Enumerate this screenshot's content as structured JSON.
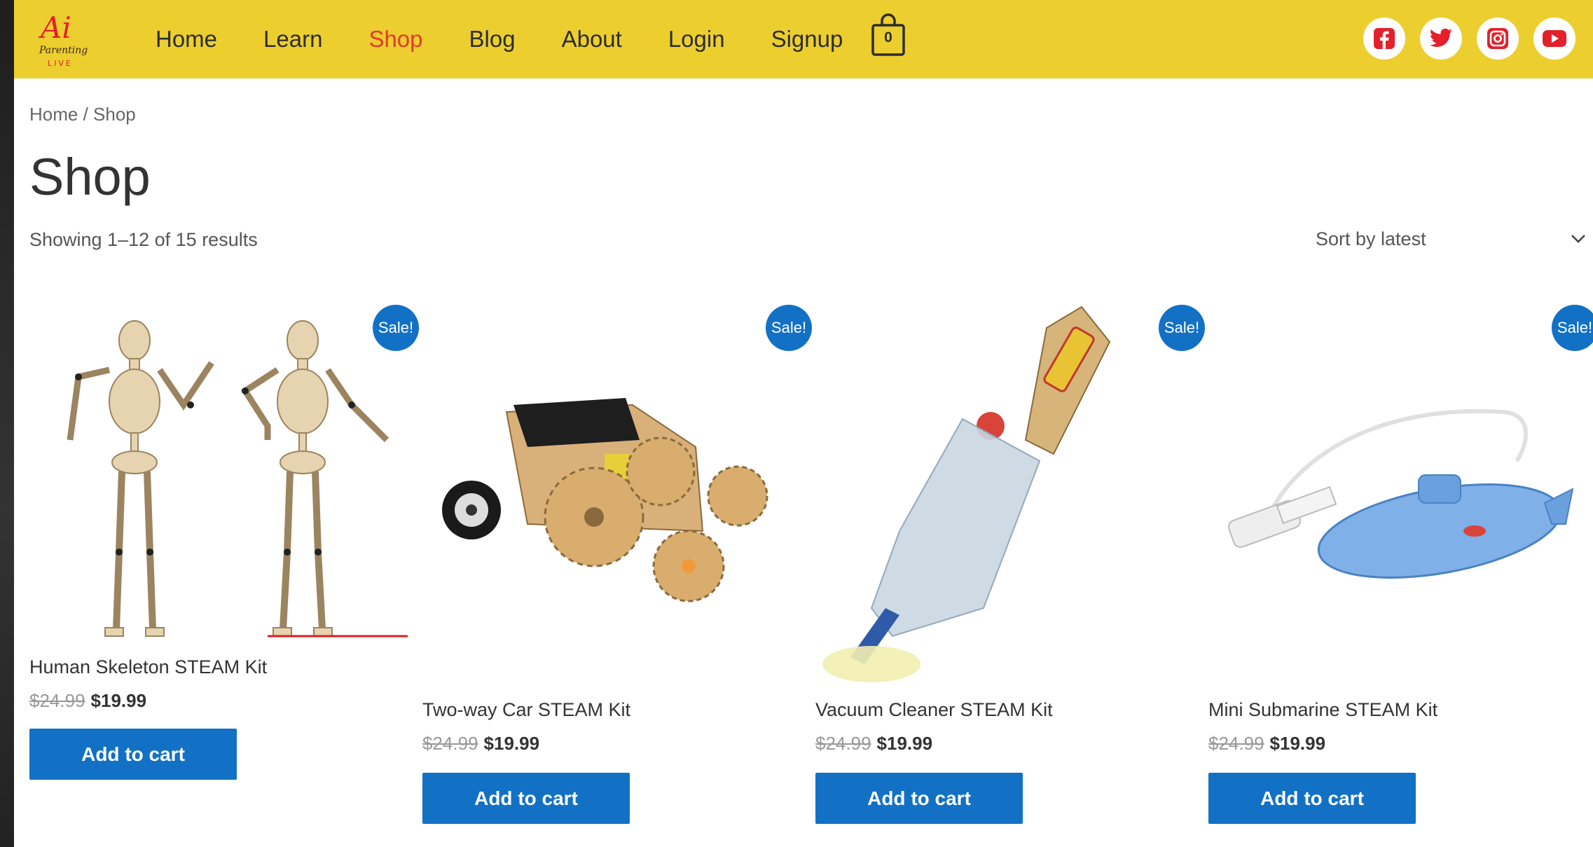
{
  "header": {
    "logo_text": "Ai Parenting Live",
    "nav": [
      "Home",
      "Learn",
      "Shop",
      "Blog",
      "About",
      "Login",
      "Signup"
    ],
    "active_nav": "Shop",
    "cart_count": "0",
    "socials": [
      "facebook-icon",
      "twitter-icon",
      "instagram-icon",
      "youtube-icon"
    ],
    "brand_color": "#ecce2f",
    "social_color": "#e3202b"
  },
  "breadcrumb": "Home / Shop",
  "page_title": "Shop",
  "result_count": "Showing 1–12 of 15 results",
  "sort": {
    "selected": "Sort by latest"
  },
  "products": [
    {
      "name": "Human Skeleton STEAM Kit",
      "old_price": "$24.99",
      "price": "$19.99",
      "badge": "Sale!",
      "button": "Add to cart"
    },
    {
      "name": "Two-way Car STEAM Kit",
      "old_price": "$24.99",
      "price": "$19.99",
      "badge": "Sale!",
      "button": "Add to cart"
    },
    {
      "name": "Vacuum Cleaner STEAM Kit",
      "old_price": "$24.99",
      "price": "$19.99",
      "badge": "Sale!",
      "button": "Add to cart"
    },
    {
      "name": "Mini Submarine STEAM Kit",
      "old_price": "$24.99",
      "price": "$19.99",
      "badge": "Sale!",
      "button": "Add to cart"
    }
  ],
  "accent_color": "#1271c4"
}
